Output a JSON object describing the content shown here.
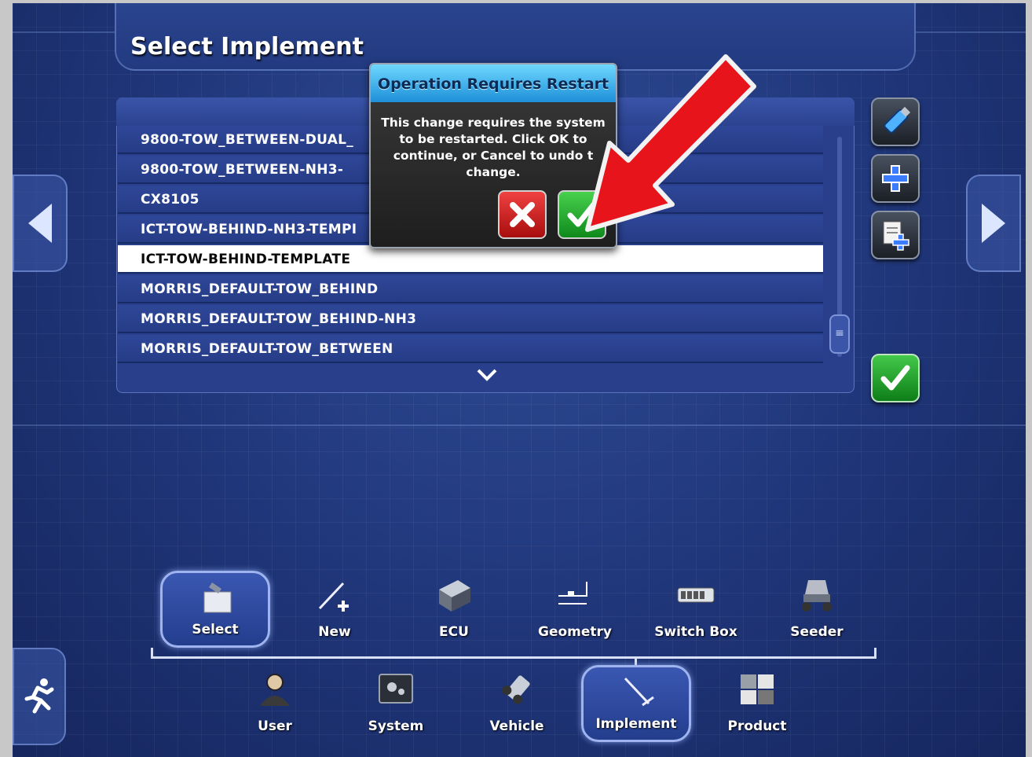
{
  "page": {
    "title": "Select Implement"
  },
  "implement_list": {
    "rows": [
      "9800-TOW_BETWEEN-DUAL_",
      "9800-TOW_BETWEEN-NH3-",
      "CX8105",
      "ICT-TOW-BEHIND-NH3-TEMPI",
      "ICT-TOW-BEHIND-TEMPLATE",
      "MORRIS_DEFAULT-TOW_BEHIND",
      "MORRIS_DEFAULT-TOW_BEHIND-NH3",
      "MORRIS_DEFAULT-TOW_BETWEEN"
    ],
    "selected_row": "ICT-TOW-BEHIND-TEMPLATE",
    "scroll_down_glyph": "⌄",
    "scroll_thumb_glyph": "≡"
  },
  "dialog": {
    "title": "Operation Requires Restart",
    "message_line1": "This change requires the system",
    "message_line2": "to be restarted. Click OK to",
    "message_line3": "continue, or Cancel to undo t",
    "message_line4": "change.",
    "cancel_icon": "close-icon",
    "ok_icon": "check-icon"
  },
  "side_buttons": [
    "usb-icon",
    "add-icon",
    "add-document-icon",
    "confirm-check-icon"
  ],
  "top_nav": [
    {
      "label": "Select",
      "icon": "folder-icon",
      "active": true
    },
    {
      "label": "New",
      "icon": "new-implement-icon",
      "active": false
    },
    {
      "label": "ECU",
      "icon": "ecu-icon",
      "active": false
    },
    {
      "label": "Geometry",
      "icon": "geometry-icon",
      "active": false
    },
    {
      "label": "Switch Box",
      "icon": "switch-box-icon",
      "active": false
    },
    {
      "label": "Seeder",
      "icon": "seeder-icon",
      "active": false
    }
  ],
  "bottom_nav": [
    {
      "label": "User",
      "icon": "user-icon",
      "active": false
    },
    {
      "label": "System",
      "icon": "system-icon",
      "active": false
    },
    {
      "label": "Vehicle",
      "icon": "vehicle-icon",
      "active": false
    },
    {
      "label": "Implement",
      "icon": "implement-icon",
      "active": true
    },
    {
      "label": "Product",
      "icon": "product-icon",
      "active": false
    }
  ],
  "colors": {
    "background": "#1f3578",
    "dialog_title": "#1e8fd8",
    "ok_green": "#0f8a1c",
    "cancel_red": "#a80d0d",
    "annotation_arrow": "#e8141b"
  }
}
